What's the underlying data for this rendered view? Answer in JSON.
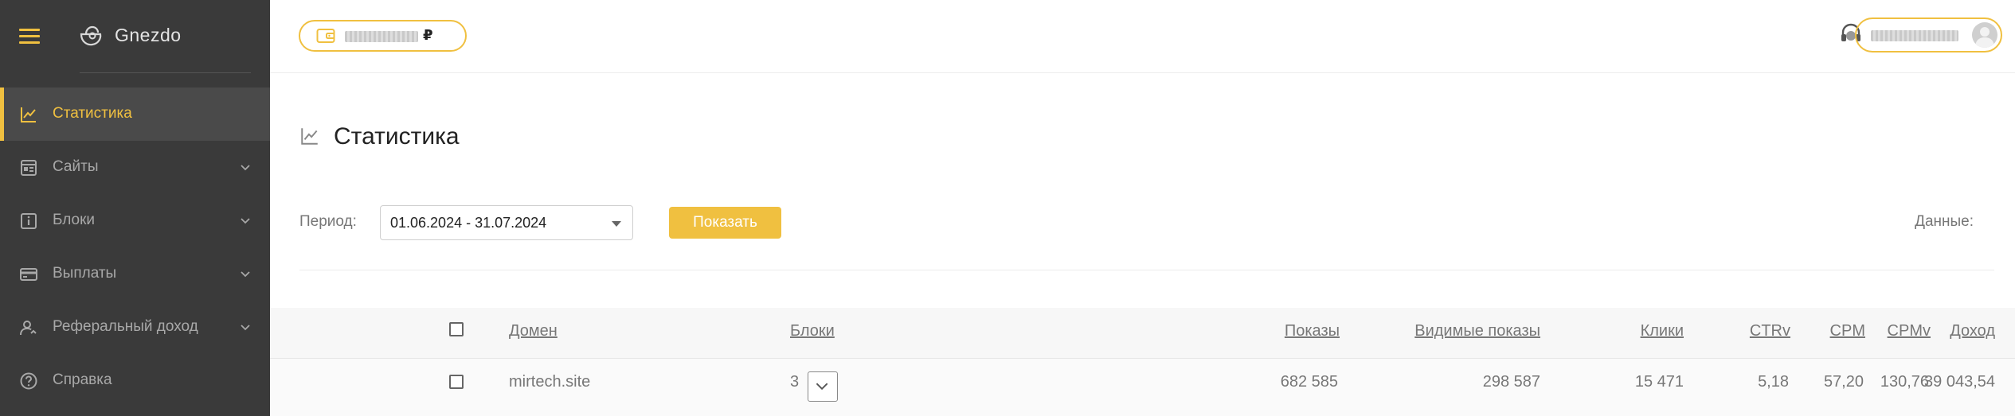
{
  "app": {
    "name": "Gnezdo"
  },
  "sidebar": {
    "items": [
      {
        "label": "Статистика",
        "icon": "chart-icon",
        "active": true
      },
      {
        "label": "Сайты",
        "icon": "sites-icon",
        "has_submenu": true
      },
      {
        "label": "Блоки",
        "icon": "info-block-icon",
        "has_submenu": true
      },
      {
        "label": "Выплаты",
        "icon": "card-icon",
        "has_submenu": true
      },
      {
        "label": "Реферальный доход",
        "icon": "referral-user-icon",
        "has_submenu": true
      },
      {
        "label": "Справка",
        "icon": "help-icon"
      }
    ]
  },
  "topbar": {
    "balance_currency": "₽",
    "balance_value_obscured": true,
    "user_name_obscured": true
  },
  "page": {
    "title": "Статистика",
    "period_label": "Период:",
    "period_value": "01.06.2024 - 31.07.2024",
    "show_button": "Показать",
    "data_label": "Данные:"
  },
  "table": {
    "columns": [
      "Домен",
      "Блоки",
      "Показы",
      "Видимые показы",
      "Клики",
      "CTRv",
      "CPM",
      "CPMv",
      "Доход"
    ],
    "rows": [
      {
        "domain": "mirtech.site",
        "blocks": "3",
        "impressions": "682 585",
        "visible_impressions": "298 587",
        "clicks": "15 471",
        "ctrv": "5,18",
        "cpm": "57,20",
        "cpmv": "130,76",
        "income": "39 043,54"
      }
    ]
  },
  "colors": {
    "accent": "#f0c040",
    "sidebar_bg": "#3a3a3a",
    "sidebar_active_bg": "#4a4a4a",
    "text_muted": "#777777"
  }
}
